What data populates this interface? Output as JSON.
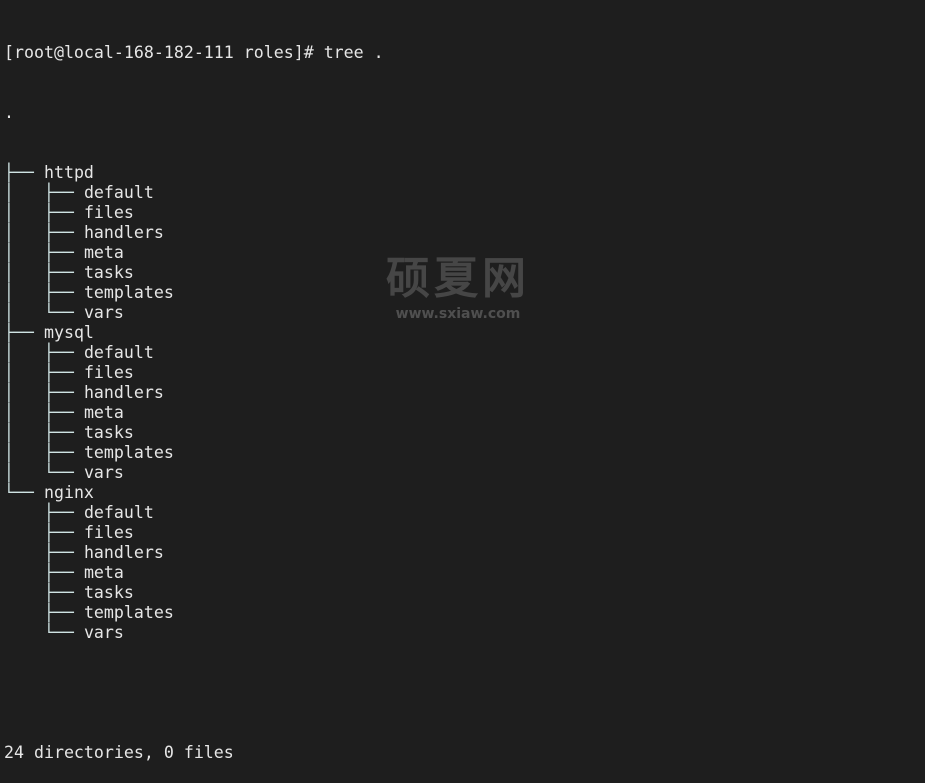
{
  "terminal": {
    "prompt": "[root@local-168-182-111 roles]# tree .",
    "root": ".",
    "roles": [
      {
        "name": "httpd",
        "children": [
          "default",
          "files",
          "handlers",
          "meta",
          "tasks",
          "templates",
          "vars"
        ]
      },
      {
        "name": "mysql",
        "children": [
          "default",
          "files",
          "handlers",
          "meta",
          "tasks",
          "templates",
          "vars"
        ]
      },
      {
        "name": "nginx",
        "children": [
          "default",
          "files",
          "handlers",
          "meta",
          "tasks",
          "templates",
          "vars"
        ]
      }
    ],
    "summary": "24 directories, 0 files"
  },
  "watermark": {
    "text": "硕夏网",
    "url": "www.sxiaw.com"
  }
}
